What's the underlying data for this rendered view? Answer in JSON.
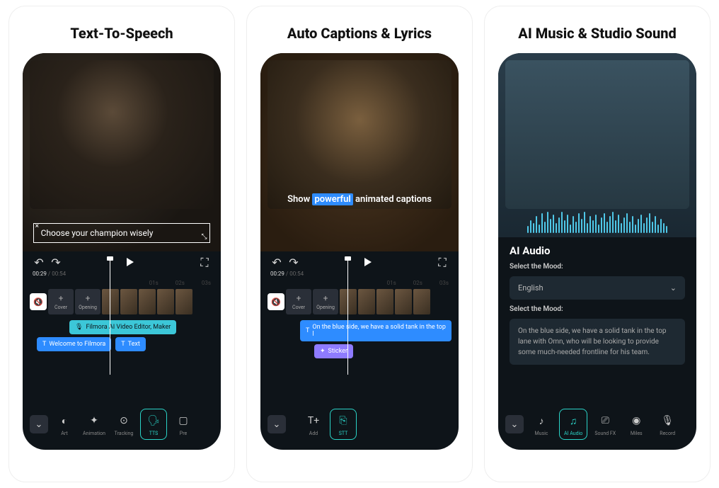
{
  "cards": [
    {
      "title": "Text-To-Speech"
    },
    {
      "title": "Auto Captions & Lyrics"
    },
    {
      "title": "AI Music & Studio Sound"
    }
  ],
  "phone1": {
    "text_overlay": "Choose your champion wisely",
    "time_current": "00:29",
    "time_total": "00:54",
    "ticks": [
      "01s",
      "02s",
      "03s"
    ],
    "cover": "Cover",
    "opening": "Opening",
    "chip_cyan": "Filmora AI Video Editor, Maker",
    "chip_blue1": "Welcome to Filmora",
    "chip_blue2": "Text",
    "tools": [
      "Art",
      "Animation",
      "Tracking",
      "TTS",
      "Pre"
    ]
  },
  "phone2": {
    "caption_pre": "Show ",
    "caption_hl": "powerful",
    "caption_post": " animated captions",
    "time_current": "00:29",
    "time_total": "00:54",
    "cover": "Cover",
    "opening": "Opening",
    "chip_blue": "On the blue side,  we have a solid tank in the top l",
    "chip_purple": "Sticker",
    "tools": [
      "Add",
      "STT"
    ]
  },
  "phone3": {
    "title": "AI Audio",
    "label1": "Select the Mood:",
    "select_val": "English",
    "label2": "Select the Mood:",
    "prompt": "On the blue side, we have a solid tank in the top lane with Omn, who will be looking to provide some much-needed frontline for his team.",
    "tools": [
      "Music",
      "AI Audio",
      "Sound FX",
      "Miles",
      "Record"
    ]
  }
}
